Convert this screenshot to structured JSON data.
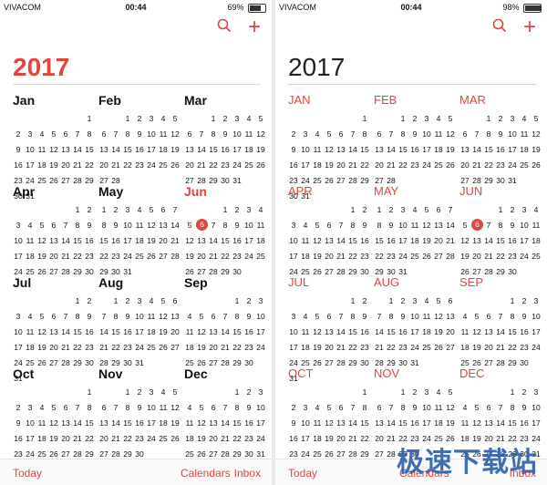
{
  "left": {
    "status": {
      "carrier": "VIVACOM",
      "time": "00:44",
      "battery": "69%",
      "battery_level": 0.69
    },
    "year": "2017",
    "toolbar": {
      "today": "Today",
      "calendars": "Calendars",
      "inbox": "Inbox"
    }
  },
  "right": {
    "status": {
      "carrier": "VIVACOM",
      "time": "00:44",
      "battery": "98%",
      "battery_level": 0.98
    },
    "year": "2017",
    "toolbar": {
      "today": "Today",
      "calendars": "Calendars",
      "inbox": "Inbox"
    }
  },
  "months_left": [
    "Jan",
    "Feb",
    "Mar",
    "Apr",
    "May",
    "Jun",
    "Jul",
    "Aug",
    "Sep",
    "Oct",
    "Nov",
    "Dec"
  ],
  "months_right": [
    "JAN",
    "FEB",
    "MAR",
    "APR",
    "MAY",
    "JUN",
    "JUL",
    "AUG",
    "SEP",
    "OCT",
    "NOV",
    "DEC"
  ],
  "month_starts": [
    6,
    2,
    2,
    5,
    0,
    3,
    5,
    1,
    4,
    6,
    2,
    4
  ],
  "month_lengths": [
    31,
    28,
    31,
    30,
    31,
    30,
    31,
    31,
    30,
    31,
    30,
    31
  ],
  "current_month_index": 5,
  "today_day": 6,
  "accent_color": "#e0463e",
  "watermark": "极速下载站"
}
